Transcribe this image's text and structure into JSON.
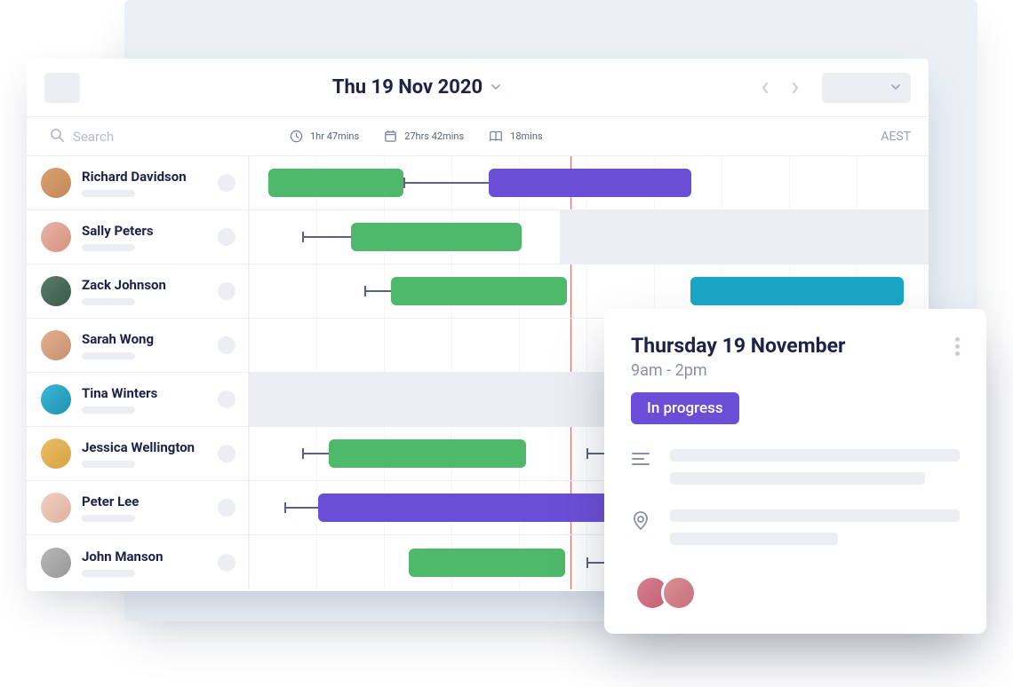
{
  "header": {
    "date_title": "Thu 19 Nov 2020"
  },
  "search": {
    "placeholder": "Search"
  },
  "stats": {
    "clock": "1hr 47mins",
    "calendar": "27hrs 42mins",
    "book": "18mins",
    "timezone": "AEST"
  },
  "users": [
    {
      "name": "Richard Davidson"
    },
    {
      "name": "Sally Peters"
    },
    {
      "name": "Zack Johnson"
    },
    {
      "name": "Sarah Wong"
    },
    {
      "name": "Tina Winters"
    },
    {
      "name": "Jessica Wellington"
    },
    {
      "name": "Peter Lee"
    },
    {
      "name": "John Manson"
    }
  ],
  "popover": {
    "title": "Thursday 19 November",
    "time": "9am - 2pm",
    "status": "In progress"
  }
}
